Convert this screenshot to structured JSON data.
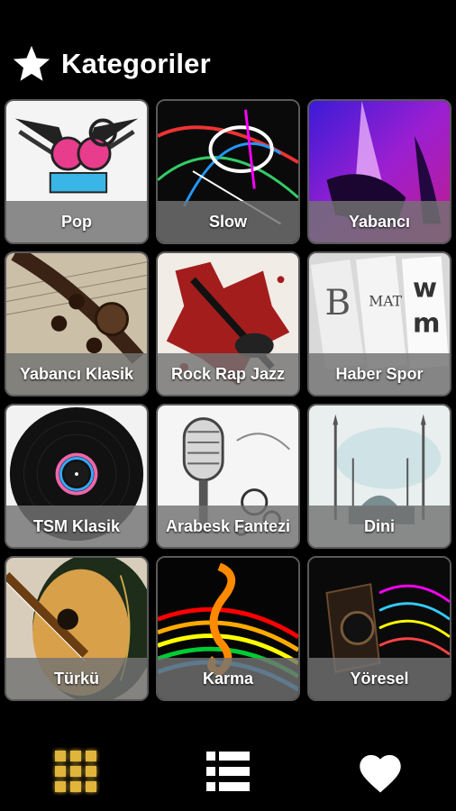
{
  "header": {
    "title": "Kategoriler",
    "icon": "star-icon"
  },
  "categories": [
    {
      "label": "Pop"
    },
    {
      "label": "Slow"
    },
    {
      "label": "Yabancı"
    },
    {
      "label": "Yabancı Klasik"
    },
    {
      "label": "Rock Rap Jazz"
    },
    {
      "label": "Haber Spor"
    },
    {
      "label": "TSM Klasik"
    },
    {
      "label": "Arabesk Fantezi"
    },
    {
      "label": "Dini"
    },
    {
      "label": "Türkü"
    },
    {
      "label": "Karma"
    },
    {
      "label": "Yöresel"
    }
  ],
  "nav": {
    "items": [
      {
        "icon": "grid-icon",
        "active": true
      },
      {
        "icon": "list-icon",
        "active": false
      },
      {
        "icon": "heart-icon",
        "active": false
      }
    ],
    "active_color": "#e0b53a"
  }
}
